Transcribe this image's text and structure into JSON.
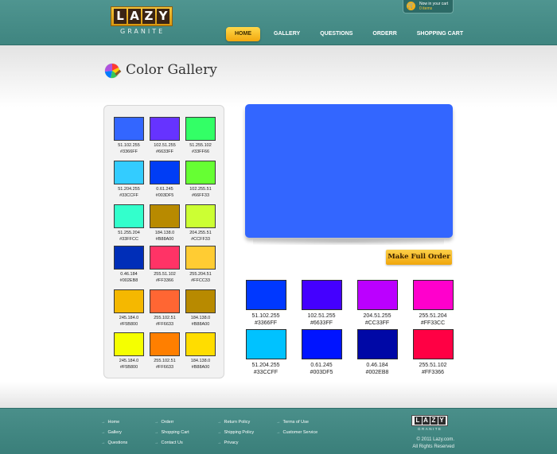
{
  "header": {
    "logo_text": "LAZY",
    "logo_letters": [
      "L",
      "A",
      "Z",
      "Y"
    ],
    "logo_sub": "GRANITE",
    "cart": {
      "label": "Now in your cart",
      "count": "0 items"
    },
    "nav": [
      "HOME",
      "GALLERY",
      "QUESTIONS",
      "ORDERR",
      "SHOPPING CART"
    ],
    "active_nav": "HOME"
  },
  "page": {
    "title": "Color Gallery",
    "icon": "color-wheel-icon"
  },
  "palette": [
    {
      "rgb": "51.102.255",
      "hex": "#3366FF",
      "color": "#3366FF"
    },
    {
      "rgb": "102.51.255",
      "hex": "#6633FF",
      "color": "#6633FF"
    },
    {
      "rgb": "51.255.102",
      "hex": "#33FF66",
      "color": "#33FF66"
    },
    {
      "rgb": "51.204.255",
      "hex": "#33CCFF",
      "color": "#33CCFF"
    },
    {
      "rgb": "0.61.245",
      "hex": "#003DF5",
      "color": "#003DF5"
    },
    {
      "rgb": "102.255.51",
      "hex": "#66FF33",
      "color": "#66FF33"
    },
    {
      "rgb": "51.255.204",
      "hex": "#33FFCC",
      "color": "#33FFCC"
    },
    {
      "rgb": "184.138.0",
      "hex": "#B88A00",
      "color": "#B88A00"
    },
    {
      "rgb": "204.255.51",
      "hex": "#CCFF33",
      "color": "#CCFF33"
    },
    {
      "rgb": "0.46.184",
      "hex": "#002EB8",
      "color": "#002EB8"
    },
    {
      "rgb": "255.51.102",
      "hex": "#FF3366",
      "color": "#FF3366"
    },
    {
      "rgb": "255.204.51",
      "hex": "#FFCC33",
      "color": "#FFCC33"
    },
    {
      "rgb": "245.184.0",
      "hex": "#F5B800",
      "color": "#F5B800"
    },
    {
      "rgb": "255.102.51",
      "hex": "#FF6633",
      "color": "#FF6633"
    },
    {
      "rgb": "184.138.0",
      "hex": "#B88A00",
      "color": "#B88A00"
    },
    {
      "rgb": "245.184.0",
      "hex": "#F5B800",
      "color": "#F5FF00"
    },
    {
      "rgb": "255.102.51",
      "hex": "#FF6633",
      "color": "#FF7F00"
    },
    {
      "rgb": "184.138.0",
      "hex": "#B88A00",
      "color": "#FFDD00"
    }
  ],
  "preview": {
    "color": "#3366FF"
  },
  "order_button": "Make Full Order",
  "selected": [
    {
      "rgb": "51.102.255",
      "hex": "#3366FF",
      "color": "#0038FF"
    },
    {
      "rgb": "102.51.255",
      "hex": "#6633FF",
      "color": "#4400FF"
    },
    {
      "rgb": "204.51.255",
      "hex": "#CC33FF",
      "color": "#BB00FF"
    },
    {
      "rgb": "255.51.204",
      "hex": "#FF33CC",
      "color": "#FF00CC"
    },
    {
      "rgb": "51.204.255",
      "hex": "#33CCFF",
      "color": "#00C2FF"
    },
    {
      "rgb": "0.61.245",
      "hex": "#003DF5",
      "color": "#0014FF"
    },
    {
      "rgb": "0.46.184",
      "hex": "#002EB8",
      "color": "#0008A6"
    },
    {
      "rgb": "255.51.102",
      "hex": "#FF3366",
      "color": "#FF0044"
    }
  ],
  "footer": {
    "col1": [
      "Home",
      "Gallery",
      "Questions"
    ],
    "col2": [
      "Orderr",
      "Shopping Cart",
      "Contact Us"
    ],
    "col3": [
      "Return Policy",
      "Shipping Policy",
      "Privacy"
    ],
    "col4": [
      "Terms of Use",
      "Customer Service"
    ],
    "logo_text": "LAZY",
    "logo_letters": [
      "L",
      "A",
      "Z",
      "Y"
    ],
    "logo_sub": "GRANITE",
    "copyright_line1": "© 2011 Lazy.com.",
    "copyright_line2": "All Rights Reserved"
  }
}
